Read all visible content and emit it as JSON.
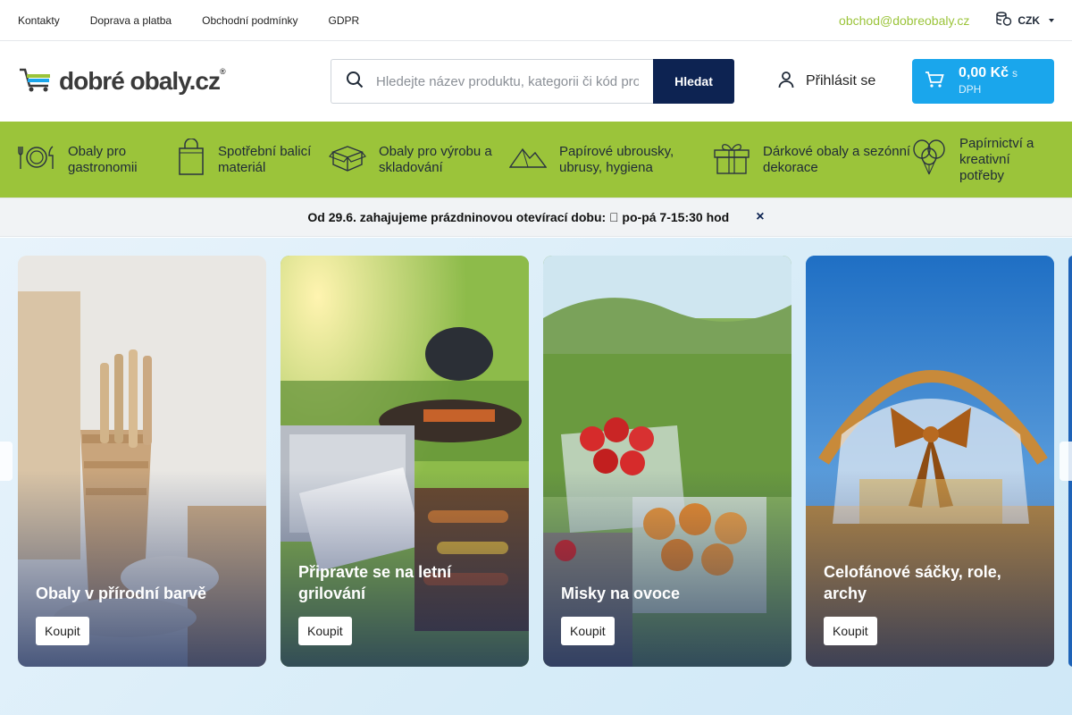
{
  "topbar": {
    "links": [
      "Kontakty",
      "Doprava a platba",
      "Obchodní podmínky",
      "GDPR"
    ],
    "email": "obchod@dobreobaly.cz",
    "currency": "CZK"
  },
  "header": {
    "logo_text": "dobré obaly.cz",
    "logo_mark": "®",
    "search_placeholder": "Hledejte název produktu, kategorii či kód produktu",
    "search_button": "Hledat",
    "login_label": "Přihlásit se",
    "cart_price": "0,00 Kč",
    "cart_vat": "s DPH"
  },
  "categories": [
    {
      "label": "Obaly pro gastronomii",
      "icon": "plate-cutlery-icon"
    },
    {
      "label": "Spotřební balicí materiál",
      "icon": "bag-icon"
    },
    {
      "label": "Obaly pro výrobu a skladování",
      "icon": "box-icon"
    },
    {
      "label": "Papírové ubrousky, ubrusy, hygiena",
      "icon": "napkin-icon"
    },
    {
      "label": "Dárkové obaly a sezónní dekorace",
      "icon": "gift-icon"
    },
    {
      "label": "Papírnictví a kreativní potřeby",
      "icon": "balloons-icon"
    }
  ],
  "notice": {
    "text": "Od 29.6. zahajujeme prázdninovou otevírací dobu: \u0000 po-pá 7-15:30 hod",
    "close": "×"
  },
  "banners": [
    {
      "title": "Obaly v přírodní barvě",
      "button": "Koupit"
    },
    {
      "title": "Připravte se na letní grilování",
      "button": "Koupit"
    },
    {
      "title": "Misky na ovoce",
      "button": "Koupit"
    },
    {
      "title": "Celofánové sáčky, role, archy",
      "button": "Koupit"
    }
  ],
  "colors": {
    "brand_green": "#9bc43a",
    "navy": "#0d2352",
    "cart_blue": "#1aa6ec"
  }
}
